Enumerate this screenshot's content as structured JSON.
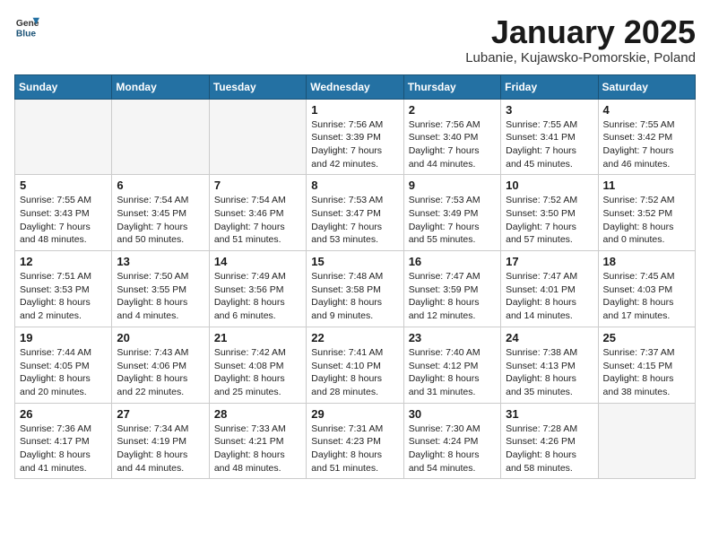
{
  "header": {
    "logo_general": "General",
    "logo_blue": "Blue",
    "title": "January 2025",
    "subtitle": "Lubanie, Kujawsko-Pomorskie, Poland"
  },
  "weekdays": [
    "Sunday",
    "Monday",
    "Tuesday",
    "Wednesday",
    "Thursday",
    "Friday",
    "Saturday"
  ],
  "weeks": [
    [
      {
        "day": "",
        "info": "",
        "empty": true
      },
      {
        "day": "",
        "info": "",
        "empty": true
      },
      {
        "day": "",
        "info": "",
        "empty": true
      },
      {
        "day": "1",
        "info": "Sunrise: 7:56 AM\nSunset: 3:39 PM\nDaylight: 7 hours\nand 42 minutes."
      },
      {
        "day": "2",
        "info": "Sunrise: 7:56 AM\nSunset: 3:40 PM\nDaylight: 7 hours\nand 44 minutes."
      },
      {
        "day": "3",
        "info": "Sunrise: 7:55 AM\nSunset: 3:41 PM\nDaylight: 7 hours\nand 45 minutes."
      },
      {
        "day": "4",
        "info": "Sunrise: 7:55 AM\nSunset: 3:42 PM\nDaylight: 7 hours\nand 46 minutes."
      }
    ],
    [
      {
        "day": "5",
        "info": "Sunrise: 7:55 AM\nSunset: 3:43 PM\nDaylight: 7 hours\nand 48 minutes."
      },
      {
        "day": "6",
        "info": "Sunrise: 7:54 AM\nSunset: 3:45 PM\nDaylight: 7 hours\nand 50 minutes."
      },
      {
        "day": "7",
        "info": "Sunrise: 7:54 AM\nSunset: 3:46 PM\nDaylight: 7 hours\nand 51 minutes."
      },
      {
        "day": "8",
        "info": "Sunrise: 7:53 AM\nSunset: 3:47 PM\nDaylight: 7 hours\nand 53 minutes."
      },
      {
        "day": "9",
        "info": "Sunrise: 7:53 AM\nSunset: 3:49 PM\nDaylight: 7 hours\nand 55 minutes."
      },
      {
        "day": "10",
        "info": "Sunrise: 7:52 AM\nSunset: 3:50 PM\nDaylight: 7 hours\nand 57 minutes."
      },
      {
        "day": "11",
        "info": "Sunrise: 7:52 AM\nSunset: 3:52 PM\nDaylight: 8 hours\nand 0 minutes."
      }
    ],
    [
      {
        "day": "12",
        "info": "Sunrise: 7:51 AM\nSunset: 3:53 PM\nDaylight: 8 hours\nand 2 minutes."
      },
      {
        "day": "13",
        "info": "Sunrise: 7:50 AM\nSunset: 3:55 PM\nDaylight: 8 hours\nand 4 minutes."
      },
      {
        "day": "14",
        "info": "Sunrise: 7:49 AM\nSunset: 3:56 PM\nDaylight: 8 hours\nand 6 minutes."
      },
      {
        "day": "15",
        "info": "Sunrise: 7:48 AM\nSunset: 3:58 PM\nDaylight: 8 hours\nand 9 minutes."
      },
      {
        "day": "16",
        "info": "Sunrise: 7:47 AM\nSunset: 3:59 PM\nDaylight: 8 hours\nand 12 minutes."
      },
      {
        "day": "17",
        "info": "Sunrise: 7:47 AM\nSunset: 4:01 PM\nDaylight: 8 hours\nand 14 minutes."
      },
      {
        "day": "18",
        "info": "Sunrise: 7:45 AM\nSunset: 4:03 PM\nDaylight: 8 hours\nand 17 minutes."
      }
    ],
    [
      {
        "day": "19",
        "info": "Sunrise: 7:44 AM\nSunset: 4:05 PM\nDaylight: 8 hours\nand 20 minutes."
      },
      {
        "day": "20",
        "info": "Sunrise: 7:43 AM\nSunset: 4:06 PM\nDaylight: 8 hours\nand 22 minutes."
      },
      {
        "day": "21",
        "info": "Sunrise: 7:42 AM\nSunset: 4:08 PM\nDaylight: 8 hours\nand 25 minutes."
      },
      {
        "day": "22",
        "info": "Sunrise: 7:41 AM\nSunset: 4:10 PM\nDaylight: 8 hours\nand 28 minutes."
      },
      {
        "day": "23",
        "info": "Sunrise: 7:40 AM\nSunset: 4:12 PM\nDaylight: 8 hours\nand 31 minutes."
      },
      {
        "day": "24",
        "info": "Sunrise: 7:38 AM\nSunset: 4:13 PM\nDaylight: 8 hours\nand 35 minutes."
      },
      {
        "day": "25",
        "info": "Sunrise: 7:37 AM\nSunset: 4:15 PM\nDaylight: 8 hours\nand 38 minutes."
      }
    ],
    [
      {
        "day": "26",
        "info": "Sunrise: 7:36 AM\nSunset: 4:17 PM\nDaylight: 8 hours\nand 41 minutes."
      },
      {
        "day": "27",
        "info": "Sunrise: 7:34 AM\nSunset: 4:19 PM\nDaylight: 8 hours\nand 44 minutes."
      },
      {
        "day": "28",
        "info": "Sunrise: 7:33 AM\nSunset: 4:21 PM\nDaylight: 8 hours\nand 48 minutes."
      },
      {
        "day": "29",
        "info": "Sunrise: 7:31 AM\nSunset: 4:23 PM\nDaylight: 8 hours\nand 51 minutes."
      },
      {
        "day": "30",
        "info": "Sunrise: 7:30 AM\nSunset: 4:24 PM\nDaylight: 8 hours\nand 54 minutes."
      },
      {
        "day": "31",
        "info": "Sunrise: 7:28 AM\nSunset: 4:26 PM\nDaylight: 8 hours\nand 58 minutes."
      },
      {
        "day": "",
        "info": "",
        "empty": true
      }
    ]
  ]
}
